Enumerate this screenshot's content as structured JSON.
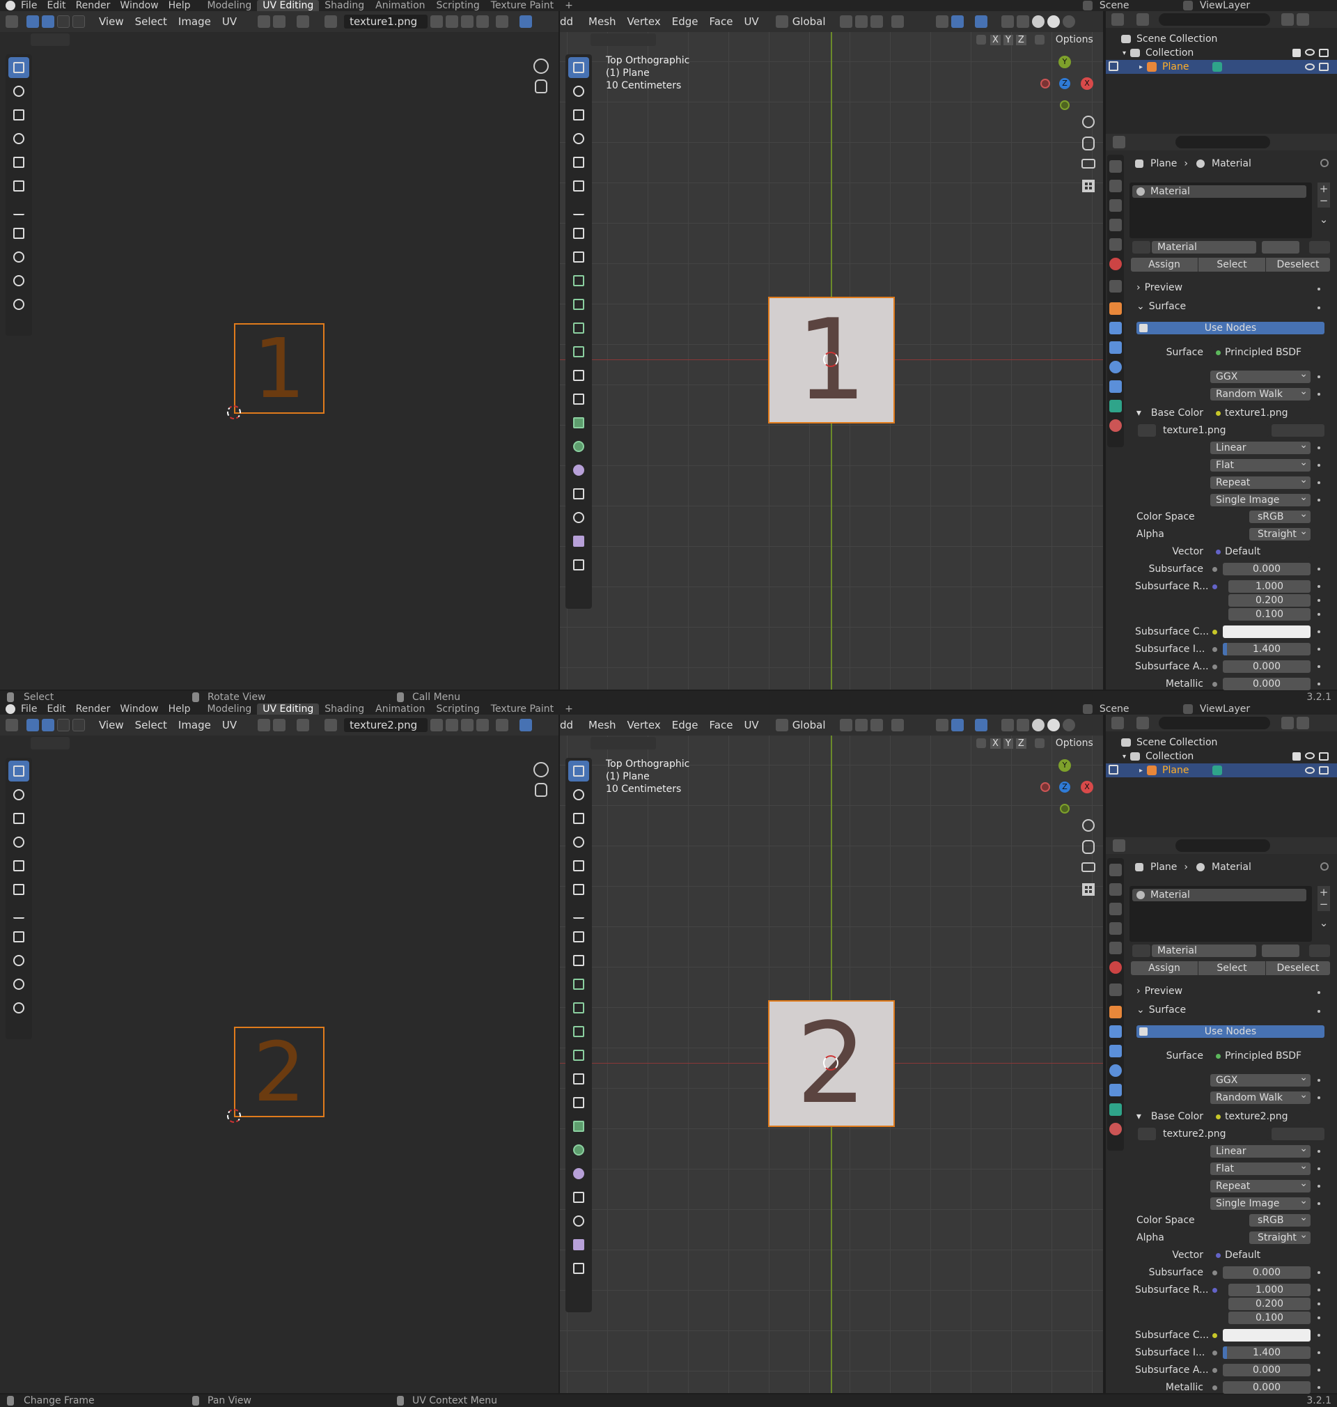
{
  "instances": [
    {
      "menus": [
        "File",
        "Edit",
        "Render",
        "Window",
        "Help"
      ],
      "workspaces": [
        "Modeling",
        "UV Editing",
        "Shading",
        "Animation",
        "Scripting",
        "Texture Paint",
        "+"
      ],
      "active_workspace": "UV Editing",
      "scene": "Scene",
      "view_layer": "ViewLayer",
      "uv_header": {
        "view": "View",
        "select": "Select",
        "image": "Image",
        "uv": "UV",
        "image_name": "texture1.png"
      },
      "vp_header": {
        "add": "dd",
        "mesh": "Mesh",
        "vertex": "Vertex",
        "edge": "Edge",
        "face": "Face",
        "uv": "UV",
        "orientation": "Global",
        "options": "Options",
        "axes": [
          "X",
          "Y",
          "Z"
        ]
      },
      "viewport_overlay": {
        "line1": "Top Orthographic",
        "line2": "(1) Plane",
        "line3": "10 Centimeters"
      },
      "gizmo": {
        "y": "Y",
        "z": "Z",
        "x": "X"
      },
      "texture_glyph": "1",
      "outliner": {
        "scene_collection": "Scene Collection",
        "collection": "Collection",
        "object": "Plane"
      },
      "props": {
        "breadcrumb_obj": "Plane",
        "breadcrumb_mat": "Material",
        "slot": "Material",
        "mat_name": "Material",
        "assign": "Assign",
        "select": "Select",
        "deselect": "Deselect",
        "preview": "Preview",
        "surface_panel": "Surface",
        "use_nodes": "Use Nodes",
        "surface_label": "Surface",
        "surface_value": "Principled BSDF",
        "distribution": "GGX",
        "subsurface_method": "Random Walk",
        "base_color_label": "Base Color",
        "base_color_value": "texture1.png",
        "image": "texture1.png",
        "interpolation": "Linear",
        "projection": "Flat",
        "extension": "Repeat",
        "source": "Single Image",
        "color_space_label": "Color Space",
        "color_space": "sRGB",
        "alpha_label": "Alpha",
        "alpha": "Straight",
        "vector_label": "Vector",
        "vector": "Default",
        "subsurface_label": "Subsurface",
        "subsurface": "0.000",
        "subsurface_r_label": "Subsurface R...",
        "subsurface_r": [
          "1.000",
          "0.200",
          "0.100"
        ],
        "subsurface_c_label": "Subsurface C...",
        "subsurface_i_label": "Subsurface I...",
        "subsurface_i": "1.400",
        "subsurface_i_fill": 0.05,
        "subsurface_a_label": "Subsurface A...",
        "subsurface_a": "0.000",
        "metallic_label": "Metallic",
        "metallic": "0.000"
      },
      "status": {
        "left": "Select",
        "mid": "Rotate View",
        "right": "Call Menu",
        "version": "3.2.1"
      },
      "colors": {
        "accent": "#4772b3",
        "uv_face": "#fde6df",
        "uv_edge": "#e07b1c",
        "vp_face": "#d3cfcf"
      }
    },
    {
      "menus": [
        "File",
        "Edit",
        "Render",
        "Window",
        "Help"
      ],
      "workspaces": [
        "Modeling",
        "UV Editing",
        "Shading",
        "Animation",
        "Scripting",
        "Texture Paint",
        "+"
      ],
      "active_workspace": "UV Editing",
      "scene": "Scene",
      "view_layer": "ViewLayer",
      "uv_header": {
        "view": "View",
        "select": "Select",
        "image": "Image",
        "uv": "UV",
        "image_name": "texture2.png"
      },
      "vp_header": {
        "add": "dd",
        "mesh": "Mesh",
        "vertex": "Vertex",
        "edge": "Edge",
        "face": "Face",
        "uv": "UV",
        "orientation": "Global",
        "options": "Options",
        "axes": [
          "X",
          "Y",
          "Z"
        ]
      },
      "viewport_overlay": {
        "line1": "Top Orthographic",
        "line2": "(1) Plane",
        "line3": "10 Centimeters"
      },
      "gizmo": {
        "y": "Y",
        "z": "Z",
        "x": "X"
      },
      "texture_glyph": "2",
      "outliner": {
        "scene_collection": "Scene Collection",
        "collection": "Collection",
        "object": "Plane"
      },
      "props": {
        "breadcrumb_obj": "Plane",
        "breadcrumb_mat": "Material",
        "slot": "Material",
        "mat_name": "Material",
        "assign": "Assign",
        "select": "Select",
        "deselect": "Deselect",
        "preview": "Preview",
        "surface_panel": "Surface",
        "use_nodes": "Use Nodes",
        "surface_label": "Surface",
        "surface_value": "Principled BSDF",
        "distribution": "GGX",
        "subsurface_method": "Random Walk",
        "base_color_label": "Base Color",
        "base_color_value": "texture2.png",
        "image": "texture2.png",
        "interpolation": "Linear",
        "projection": "Flat",
        "extension": "Repeat",
        "source": "Single Image",
        "color_space_label": "Color Space",
        "color_space": "sRGB",
        "alpha_label": "Alpha",
        "alpha": "Straight",
        "vector_label": "Vector",
        "vector": "Default",
        "subsurface_label": "Subsurface",
        "subsurface": "0.000",
        "subsurface_r_label": "Subsurface R...",
        "subsurface_r": [
          "1.000",
          "0.200",
          "0.100"
        ],
        "subsurface_c_label": "Subsurface C...",
        "subsurface_i_label": "Subsurface I...",
        "subsurface_i": "1.400",
        "subsurface_i_fill": 0.05,
        "subsurface_a_label": "Subsurface A...",
        "subsurface_a": "0.000",
        "metallic_label": "Metallic",
        "metallic": "0.000"
      },
      "status": {
        "left": "Change Frame",
        "mid": "Pan View",
        "right": "UV Context Menu",
        "version": "3.2.1"
      },
      "colors": {
        "accent": "#4772b3",
        "uv_face": "#fde6df",
        "uv_edge": "#e07b1c",
        "vp_face": "#d3cfcf"
      }
    }
  ]
}
